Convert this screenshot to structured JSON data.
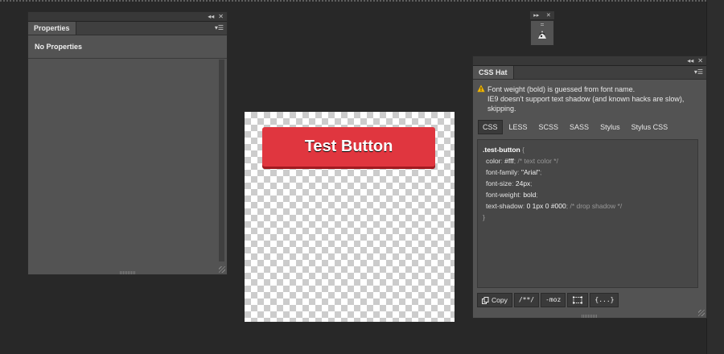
{
  "properties_panel": {
    "tab_label": "Properties",
    "no_properties": "No Properties"
  },
  "canvas": {
    "button_text": "Test Button"
  },
  "csshat": {
    "tab_label": "CSS Hat",
    "warning_line1": "Font weight (bold) is guessed from font name.",
    "warning_line2": "IE9 doesn't support text shadow (and known hacks are slow),",
    "warning_line3": "skipping.",
    "tabs": [
      "CSS",
      "LESS",
      "SCSS",
      "SASS",
      "Stylus",
      "Stylus CSS"
    ],
    "active_tab": "CSS",
    "code": {
      "selector": ".test-button",
      "open_brace": "{",
      "close_brace": "}",
      "lines": [
        {
          "prop": "color",
          "val": "#fff",
          "comment": "/* text color */"
        },
        {
          "prop": "font-family",
          "val": "\"Arial\"",
          "comment": ""
        },
        {
          "prop": "font-size",
          "val": "24px",
          "comment": ""
        },
        {
          "prop": "font-weight",
          "val": "bold",
          "comment": ""
        },
        {
          "prop": "text-shadow",
          "val": "0 1px 0 #000",
          "comment": "/* drop shadow */"
        }
      ]
    },
    "toolbar": {
      "copy": "Copy",
      "comments": "/**/",
      "moz": "-moz",
      "braces": "{...}"
    }
  },
  "colors": {
    "button_red": "#e0363f",
    "panel_gray": "#535353",
    "background": "#282828"
  }
}
